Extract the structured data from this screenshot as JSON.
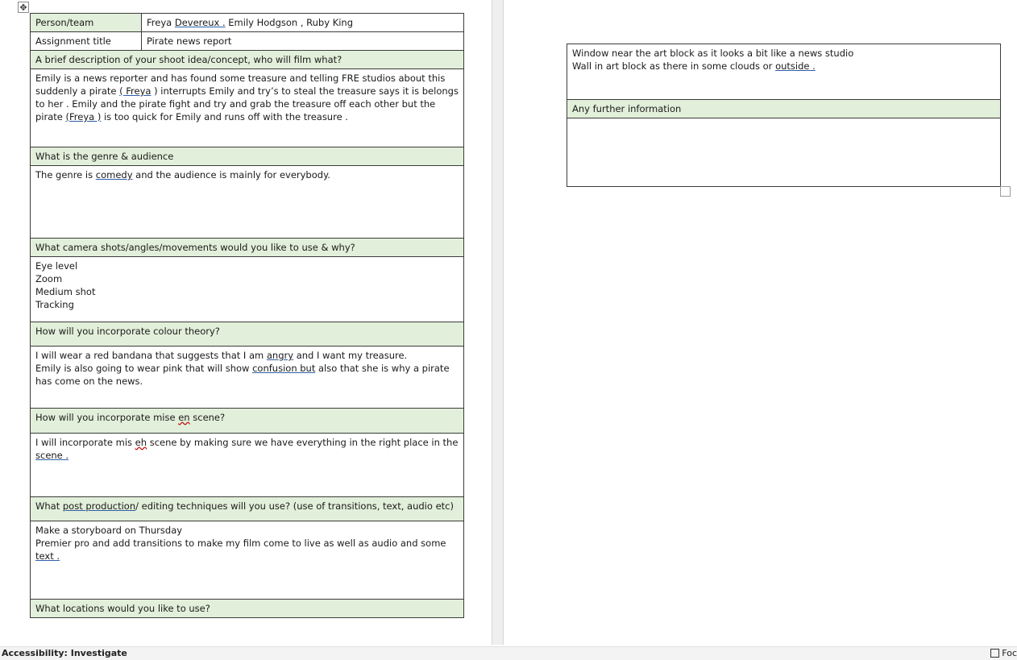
{
  "left_table": {
    "person_team_label": "Person/team",
    "person_team_name1": "Freya",
    "person_team_name2": "Devereux .",
    "person_team_rest": "Emily Hodgson , Ruby King",
    "assignment_label": "Assignment title",
    "assignment_value": "Pirate news report",
    "q1_heading": "A brief description of your shoot idea/concept, who will film what?",
    "q1_answer": {
      "p1": "Emily is a news reporter and has found some treasure and telling FRE studios about this suddenly a pirate ",
      "u1": "( Freya",
      "p2": " ) interrupts  Emily and try’s to steal the treasure says it is belongs to her . Emily and the pirate fight and try and grab the treasure off each other but the pirate ",
      "u2": "(Freya )",
      "p3": " is too quick for Emily and runs  off with the treasure ."
    },
    "q2_heading": "What is the genre & audience",
    "q2_answer": {
      "p1": "The genre is ",
      "u1": "comedy",
      "p2": " and the audience is mainly for everybody."
    },
    "q3_heading": "What camera shots/angles/movements would you like to use & why?",
    "q3_answer": "Eye level\nZoom\nMedium shot\nTracking",
    "q4_heading": "How will you incorporate colour theory?",
    "q4_answer": {
      "p1": "I will wear a red bandana that suggests that I am ",
      "u1": "angry",
      "p2": " and I want my treasure.",
      "p3": "Emily is also going to wear pink that will show ",
      "u2": "confusion  but",
      "p4": " also that she is why a pirate has come on the news."
    },
    "q5_heading": {
      "p1": "How will you incorporate mise ",
      "w1": "en",
      "p2": " scene?"
    },
    "q5_answer": {
      "p1": "I will incorporate mis ",
      "w1": "eh",
      "p2": " scene by making sure we have everything in the right place in the ",
      "u1": "scene ."
    },
    "q6_heading": {
      "p1": "What ",
      "u1": "post production",
      "p2": "/ editing techniques will you use? (use of transitions, text, audio etc)"
    },
    "q6_answer": {
      "l1": "Make a storyboard on Thursday",
      "p1": "Premier pro and add transitions to make my film come to live as well as audio and some ",
      "u1": "text ."
    },
    "q7_heading": "What locations would you like to use?"
  },
  "right_table": {
    "locations_line1": "Window near the art block as it looks a bit like a news studio",
    "locations_line2_p1": "Wall in art block as there in some clouds or ",
    "locations_line2_u1": "outside .",
    "further_heading": "Any further information",
    "further_answer": ""
  },
  "status_bar": {
    "accessibility": "Accessibility: Investigate",
    "focus": "Foc"
  },
  "colors": {
    "header_fill": "#e2efda",
    "border": "#3b3b3b",
    "spell_underline": "#c00000",
    "grammar_underline": "#2e5fa8"
  }
}
